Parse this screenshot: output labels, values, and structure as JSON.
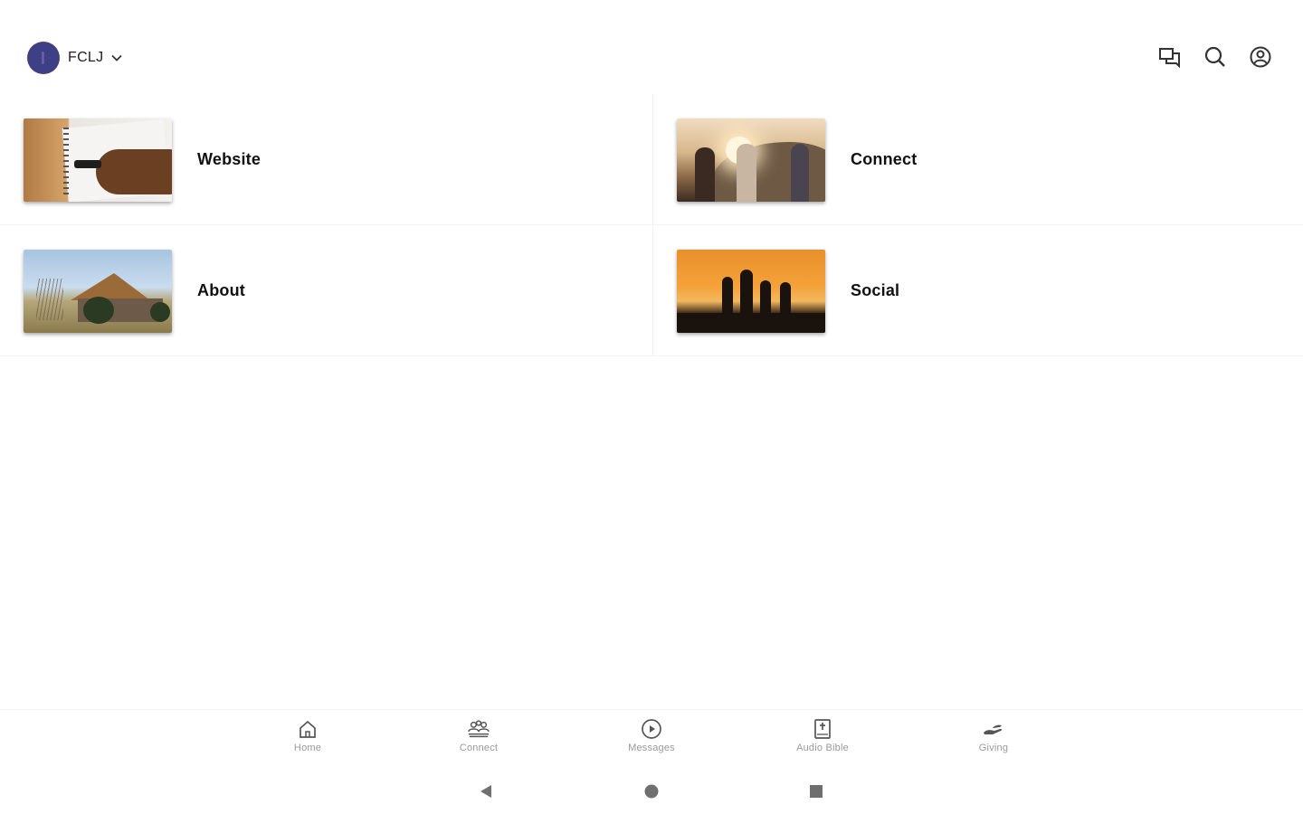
{
  "header": {
    "org_name": "FCLJ",
    "icons": [
      "chat-icon",
      "search-icon",
      "account-icon"
    ]
  },
  "tiles": [
    {
      "label": "Website",
      "thumbnail": "notebook-writing-photo"
    },
    {
      "label": "Connect",
      "thumbnail": "people-on-hill-sunset-photo"
    },
    {
      "label": "About",
      "thumbnail": "church-building-photo"
    },
    {
      "label": "Social",
      "thumbnail": "silhouettes-sunset-photo"
    }
  ],
  "bottom_nav": {
    "items": [
      {
        "label": "Home",
        "icon": "home-icon"
      },
      {
        "label": "Connect",
        "icon": "group-icon"
      },
      {
        "label": "Messages",
        "icon": "play-circle-icon"
      },
      {
        "label": "Audio Bible",
        "icon": "bible-icon"
      },
      {
        "label": "Giving",
        "icon": "giving-hand-icon"
      }
    ]
  },
  "system_nav": {
    "buttons": [
      "back-icon",
      "home-circle-icon",
      "recents-icon"
    ]
  },
  "colors": {
    "avatar": "#3f3f86",
    "text_primary": "#111111",
    "nav_label": "#9a9a9a",
    "icon": "#333333"
  }
}
